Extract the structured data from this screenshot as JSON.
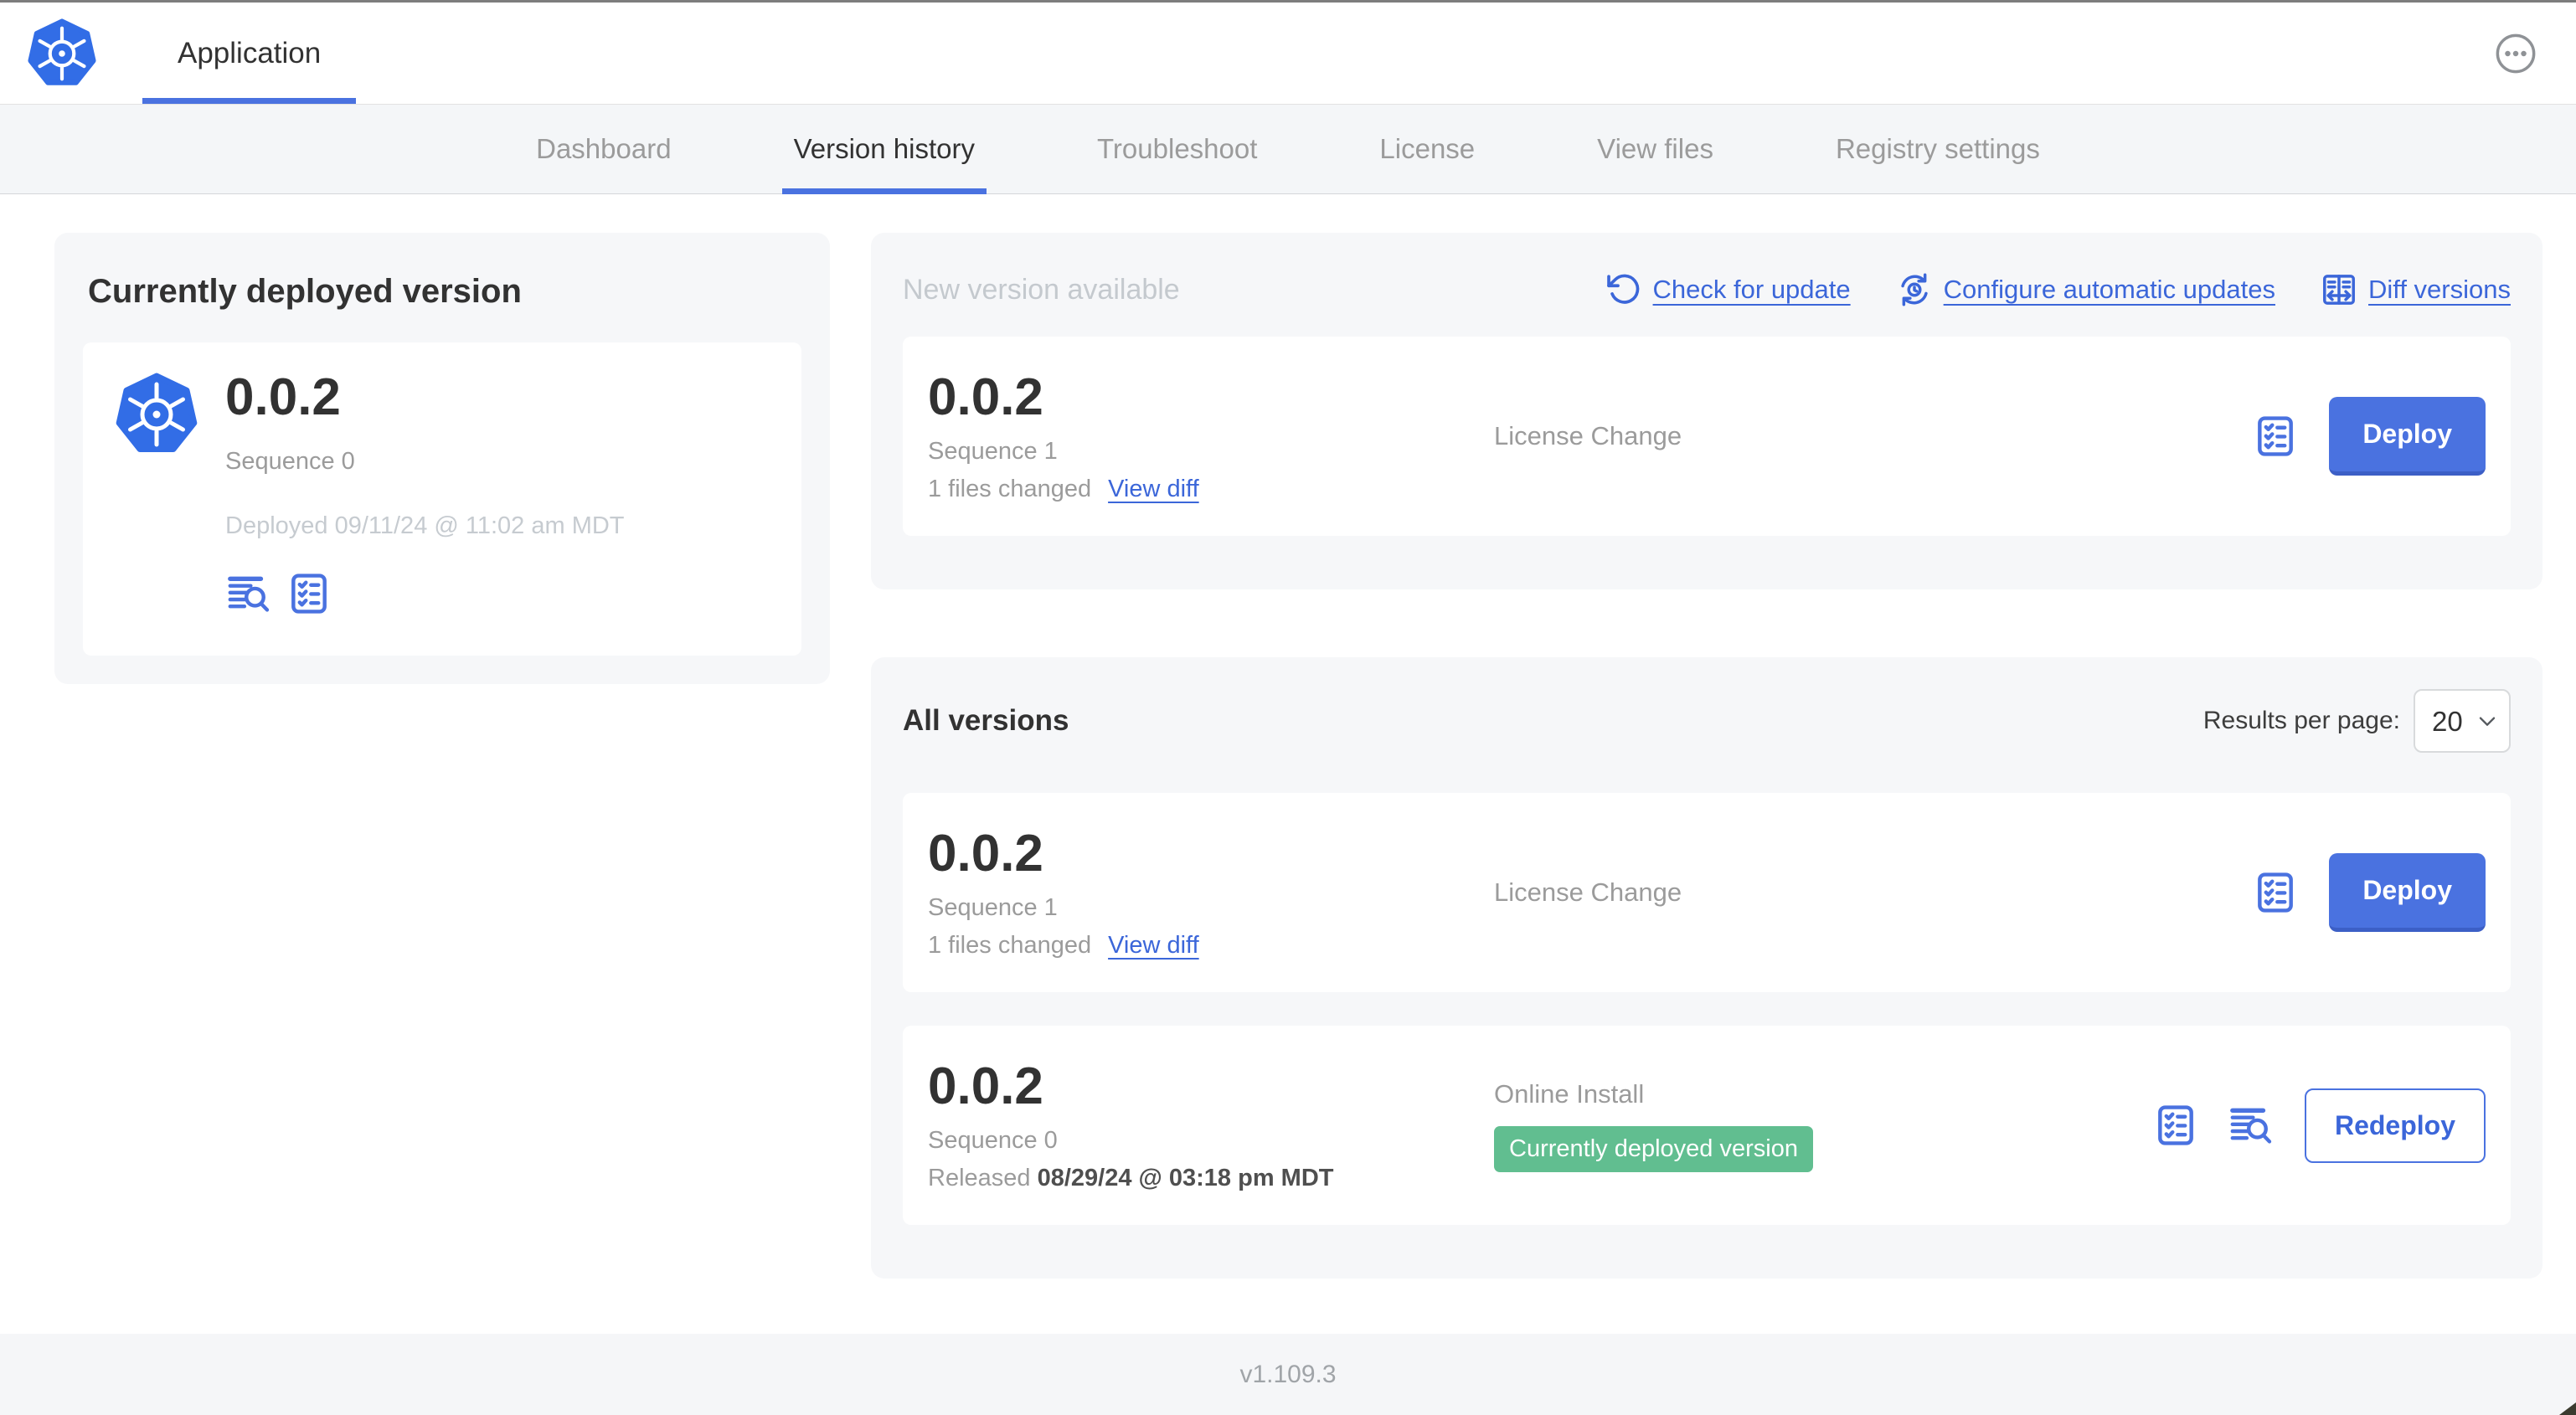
{
  "header": {
    "app_title": "Application"
  },
  "nav": {
    "tabs": [
      "Dashboard",
      "Version history",
      "Troubleshoot",
      "License",
      "View files",
      "Registry settings"
    ],
    "active_tab": "Version history"
  },
  "current_deployed": {
    "title": "Currently deployed version",
    "version": "0.0.2",
    "sequence": "Sequence 0",
    "deployed": "Deployed 09/11/24 @ 11:02 am MDT",
    "icons": [
      "logs-icon",
      "config-checklist-icon"
    ]
  },
  "new_version": {
    "title": "New version available",
    "actions": {
      "check_for_update": "Check for update",
      "configure_automatic_updates": "Configure automatic updates",
      "diff_versions": "Diff versions"
    },
    "row": {
      "version": "0.0.2",
      "sequence": "Sequence 1",
      "files_changed": "1 files changed",
      "view_diff": "View diff",
      "source_label": "License Change",
      "deploy_label": "Deploy"
    }
  },
  "all_versions": {
    "title": "All versions",
    "results_per_page_label": "Results per page:",
    "results_per_page_value": "20",
    "rows": [
      {
        "version": "0.0.2",
        "sequence": "Sequence 1",
        "files_changed": "1 files changed",
        "view_diff": "View diff",
        "source_label": "License Change",
        "deploy_label": "Deploy"
      },
      {
        "version": "0.0.2",
        "sequence": "Sequence 0",
        "released_prefix": "Released",
        "released_date": "08/29/24 @ 03:18 pm MDT",
        "source_label": "Online Install",
        "badge": "Currently deployed version",
        "redeploy_label": "Redeploy"
      }
    ]
  },
  "footer": {
    "app_version": "v1.109.3"
  },
  "colors": {
    "accent_blue": "#4A72E0",
    "link_blue": "#3B66D9",
    "logo_blue": "#326DE6",
    "badge_green": "#61BE90",
    "text_dark": "#323232",
    "text_gray": "#9B9B9B",
    "text_silver": "#C6CBD0"
  }
}
